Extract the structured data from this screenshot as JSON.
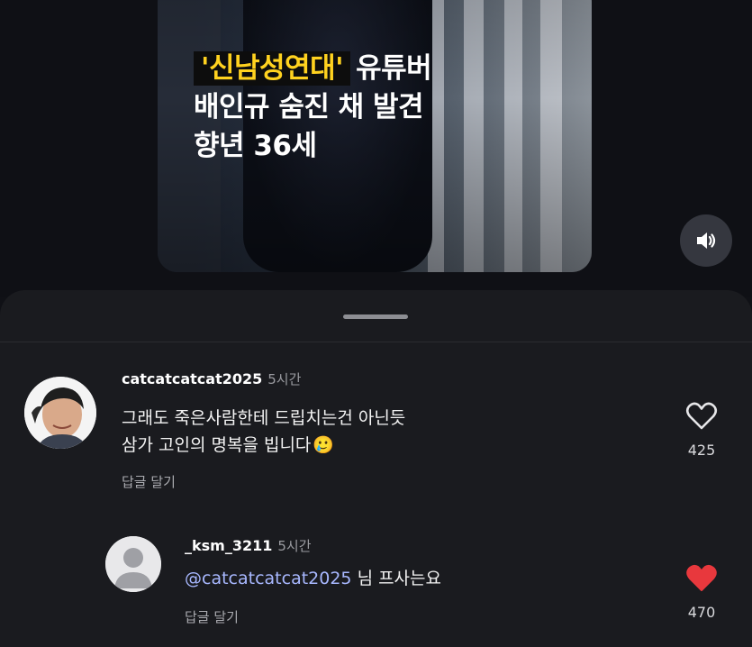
{
  "video": {
    "headline_tag": "'신남성연대'",
    "headline_line1_rest": "유튜버",
    "headline_line2": "배인규 숨진 채 발견",
    "headline_line3": "향년 36세",
    "volume_icon": "speaker-volume-icon"
  },
  "comments": [
    {
      "username": "catcatcatcat2025",
      "time": "5시간",
      "text_line1": "그래도 죽은사람한테  드립치는건 아닌듯",
      "text_line2": "삼가 고인의 명복을 빕니다",
      "emoji": "🥲",
      "reply_label": "답글 달기",
      "likes": "425",
      "liked": false
    },
    {
      "username": "_ksm_3211",
      "time": "5시간",
      "mention": "@catcatcatcat2025",
      "text": "님 프사는요",
      "reply_label": "답글 달기",
      "likes": "470",
      "liked": true
    }
  ],
  "colors": {
    "background": "#101116",
    "sheet": "#1a1b1f",
    "headline_tag_text": "#ffd21f",
    "mention": "#a8b8ff",
    "like_active": "#e8383d"
  }
}
